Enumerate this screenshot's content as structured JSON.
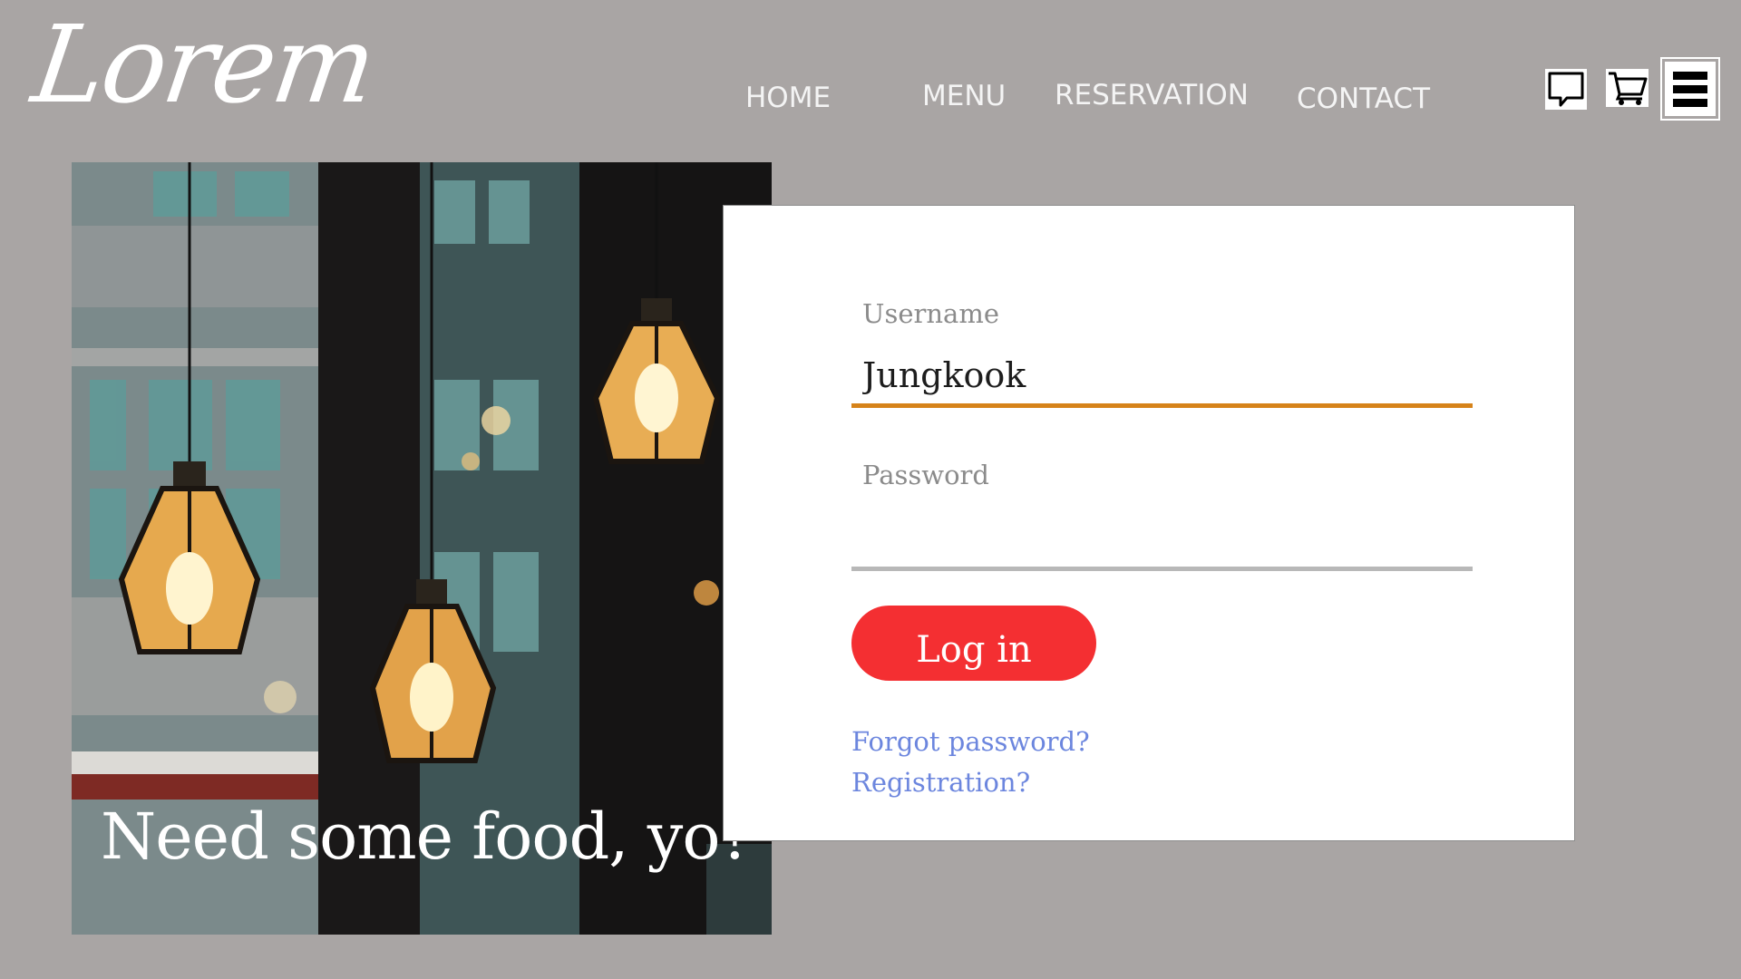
{
  "brand": {
    "logo_text": "Lorem"
  },
  "nav": {
    "items": [
      {
        "label": "HOME"
      },
      {
        "label": "MENU"
      },
      {
        "label": "RESERVATION"
      },
      {
        "label": "CONTACT"
      }
    ]
  },
  "header_icons": [
    "chat-icon",
    "cart-icon",
    "menu-icon"
  ],
  "hero": {
    "tagline": "Need some food, yo?"
  },
  "login": {
    "username_label": "Username",
    "username_value": "Jungkook",
    "password_label": "Password",
    "password_value": "",
    "submit_label": "Log in",
    "forgot_link": "Forgot password?",
    "register_link": "Registration?"
  },
  "colors": {
    "background": "#a9a5a4",
    "accent_underline": "#d6831a",
    "button": "#f42f32",
    "link": "#6c86de"
  }
}
